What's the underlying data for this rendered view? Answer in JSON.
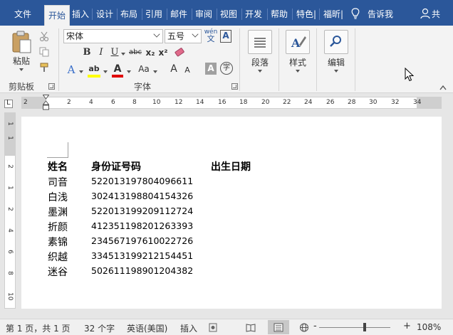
{
  "ribbon_tabs": [
    "文件",
    "开始",
    "插入",
    "设计",
    "布局",
    "引用",
    "邮件",
    "审阅",
    "视图",
    "开发",
    "帮助",
    "特色|",
    "福昕|"
  ],
  "tell_me": "告诉我",
  "share": "共",
  "clipboard": {
    "paste": "粘贴",
    "group": "剪贴板"
  },
  "font": {
    "name": "宋体",
    "size": "五号",
    "group": "字体",
    "pinyin_top": "wén",
    "pinyin_bottom": "文",
    "border_char": "A",
    "bold": "B",
    "italic": "I",
    "underline": "U",
    "strike": "abc",
    "subscript": "x₂",
    "superscript": "x²",
    "effects": "A",
    "highlight": "ab",
    "font_color": "A",
    "change_case": "Aa",
    "grow": "A",
    "shrink": "A",
    "shade": "A",
    "enclose": "字"
  },
  "paragraph": {
    "label": "段落"
  },
  "styles": {
    "label": "样式"
  },
  "editing": {
    "label": "编辑"
  },
  "ruler": {
    "marks": [
      "2",
      "2",
      "4",
      "6",
      "8",
      "10",
      "12",
      "14",
      "16",
      "18",
      "20",
      "22",
      "24",
      "26",
      "28",
      "30",
      "32",
      "34"
    ],
    "vmarks": [
      "1",
      "1",
      "2",
      "1",
      "2",
      "4",
      "6",
      "8",
      "10"
    ]
  },
  "document": {
    "headers": [
      "姓名",
      "身份证号码",
      "出生日期"
    ],
    "rows": [
      [
        "司音",
        "522013197804096611"
      ],
      [
        "白浅",
        "302413198804154326"
      ],
      [
        "墨渊",
        "522013199209112724"
      ],
      [
        "折颜",
        "412351198201263393"
      ],
      [
        "素锦",
        "234567197610022726"
      ],
      [
        "织越",
        "334513199212154451"
      ],
      [
        "迷谷",
        "502611198901204382"
      ]
    ]
  },
  "status": {
    "page": "第 1 页，共 1 页",
    "words": "32 个字",
    "lang": "英语(美国)",
    "mode": "插入",
    "zoom": "108%",
    "minus": "-",
    "plus": "+"
  },
  "colors": {
    "brand": "#2b579a",
    "highlight": "#ffff00",
    "font_color": "#e00000"
  }
}
